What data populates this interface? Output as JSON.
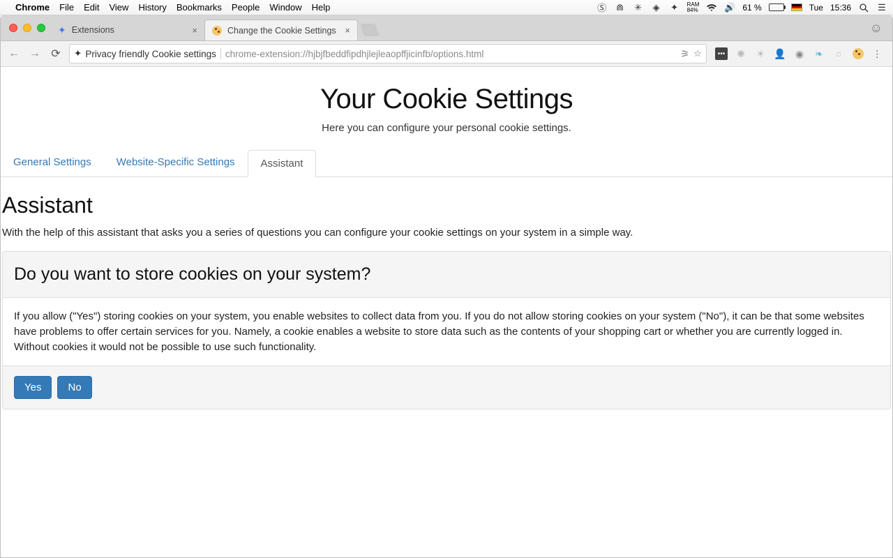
{
  "menubar": {
    "app": "Chrome",
    "items": [
      "File",
      "Edit",
      "View",
      "History",
      "Bookmarks",
      "People",
      "Window",
      "Help"
    ],
    "ram_label": "RAM",
    "ram_value": "84%",
    "battery": "61 %",
    "day": "Tue",
    "time": "15:36"
  },
  "browser": {
    "tabs": [
      {
        "title": "Extensions",
        "active": false
      },
      {
        "title": "Change the Cookie Settings",
        "active": true
      }
    ],
    "omnibox_label": "Privacy friendly Cookie settings",
    "url": "chrome-extension://hjbjfbeddfipdhjlejleaopffjicinfb/options.html"
  },
  "page": {
    "title": "Your Cookie Settings",
    "subtitle": "Here you can configure your personal cookie settings.",
    "nav": {
      "general": "General Settings",
      "website": "Website-Specific Settings",
      "assistant": "Assistant"
    },
    "section_heading": "Assistant",
    "section_lead": "With the help of this assistant that asks you a series of questions you can configure your cookie settings on your system in a simple way.",
    "panel": {
      "question": "Do you want to store cookies on your system?",
      "body": "If you allow (\"Yes\") storing cookies on your system, you enable websites to collect data from you. If you do not allow storing cookies on your system (\"No\"), it can be that some websites have problems to offer certain services for you. Namely, a cookie enables a website to store data such as the contents of your shopping cart or whether you are currently logged in. Without cookies it would not be possible to use such functionality.",
      "yes": "Yes",
      "no": "No"
    }
  }
}
